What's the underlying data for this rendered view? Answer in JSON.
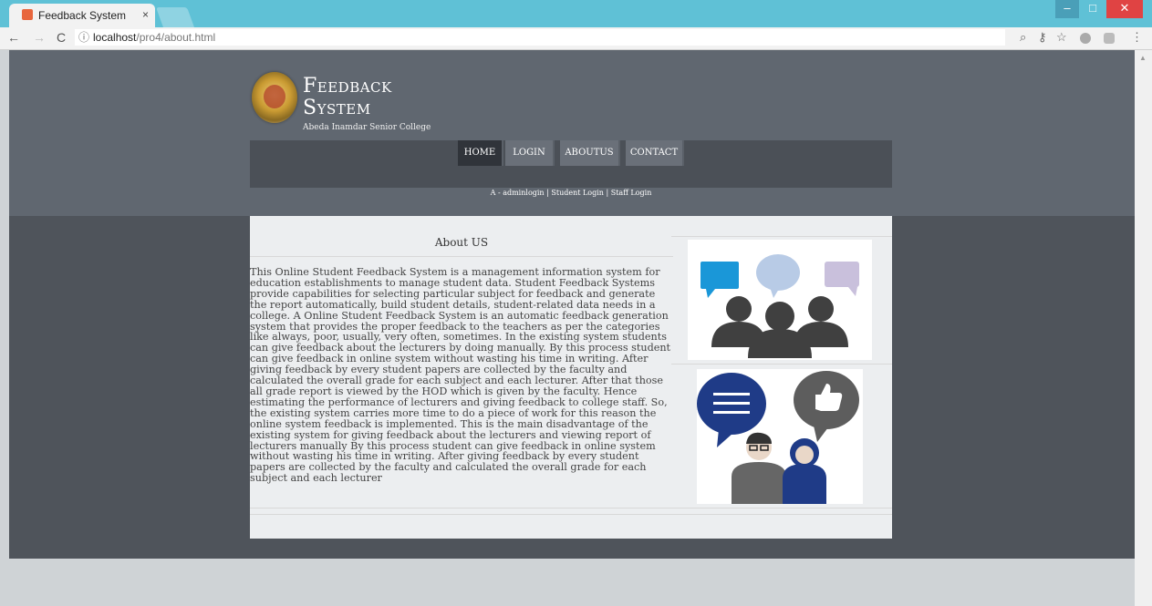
{
  "browser": {
    "tab_title": "Feedback System",
    "tab_close": "×",
    "url_host": "localhost",
    "url_path": "/pro4/about.html",
    "nav_back": "←",
    "nav_forward": "→",
    "nav_reload": "C",
    "info_symbol": "ⓘ",
    "win_min": "–",
    "win_max": "□",
    "win_close": "✕",
    "zoom_icon": "⌕",
    "key_icon": "⚷",
    "star_icon": "☆",
    "menu_icon": "⋮"
  },
  "site": {
    "title_line1": "Feedback",
    "title_line2": "System",
    "subtitle": "Abeda Inamdar Senior College"
  },
  "menu": [
    "HOME",
    "LOGIN",
    "ABOUTUS",
    "CONTACT"
  ],
  "active_menu": "HOME",
  "login_links": "A - adminlogin | Student Login | Staff Login",
  "about": {
    "heading": "About US",
    "text": "This Online Student Feedback System is a management information system for education establishments to manage student data. Student Feedback Systems provide capabilities for selecting particular subject for feedback and generate the report automatically, build student details, student-related data needs in a college. A Online Student Feedback System is an automatic feedback generation system that provides the proper feedback to the teachers as per the categories like always, poor, usually, very often, sometimes. In the existing system students can give feedback about the lecturers by doing manually. By this process student can give feedback in online system without wasting his time in writing. After giving feedback by every student papers are collected by the faculty and calculated the overall grade for each subject and each lecturer. After that those all grade report is viewed by the HOD which is given by the faculty. Hence estimating the performance of lecturers and giving feedback to college staff. So, the existing system carries more time to do a piece of work for this reason the online system feedback is implemented. This is the main disadvantage of the existing system for giving feedback about the lecturers and viewing report of lecturers manually By this process student can give feedback in online system without wasting his time in writing. After giving feedback by every student papers are collected by the faculty and calculated the overall grade for each subject and each lecturer"
  },
  "colors": {
    "header_bg": "#606770",
    "band_bg": "#4f545b",
    "content_bg": "#eceef0",
    "tab_strip": "#5fc1d6"
  },
  "icons": {
    "illustration_1": "group-speech-bubbles",
    "illustration_2": "feedback-thumbs-up-people"
  }
}
